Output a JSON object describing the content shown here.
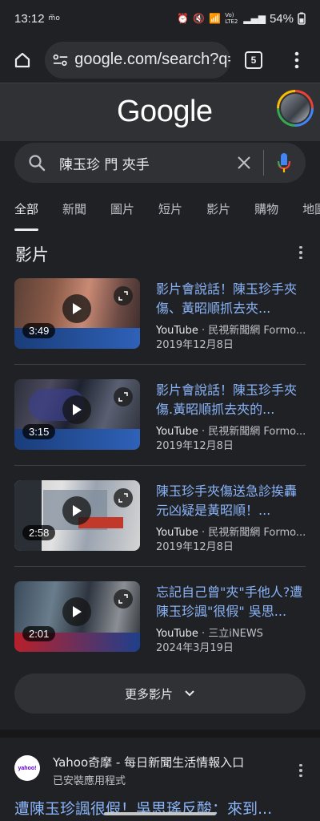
{
  "status_bar": {
    "time": "13:12",
    "small_tag": "m̅o",
    "net_label": "Vo) LTE2",
    "battery": "54%"
  },
  "browser": {
    "url": "google.com/search?q=",
    "tab_count": "5"
  },
  "google": {
    "logo_text": "Google"
  },
  "search": {
    "query": "陳玉珍 門 夾手"
  },
  "tabs": [
    {
      "label": "全部",
      "active": true
    },
    {
      "label": "新聞"
    },
    {
      "label": "圖片"
    },
    {
      "label": "短片"
    },
    {
      "label": "影片"
    },
    {
      "label": "購物"
    },
    {
      "label": "地圖"
    }
  ],
  "videos_section": {
    "title": "影片",
    "items": [
      {
        "title": "影片會說話！陳玉珍手夾傷、黃昭順抓去夾...",
        "source": "YouTube",
        "channel": " · 民視新聞網 Formo...",
        "date": "2019年12月8日",
        "duration": "3:49"
      },
      {
        "title": "影片會說話！陳玉珍手夾傷.黃昭順抓去夾的...",
        "source": "YouTube",
        "channel": " · 民視新聞網 Formo...",
        "date": "2019年12月8日",
        "duration": "3:15"
      },
      {
        "title": "陳玉珍手夾傷送急診挨轟元凶疑是黃昭順！...",
        "source": "YouTube",
        "channel": " · 民視新聞網 Formo...",
        "date": "2019年12月8日",
        "duration": "2:58"
      },
      {
        "title": "忘記自己曾\"夾\"手他人?遭陳玉珍諷\"很假\" 吳思...",
        "source": "YouTube",
        "channel": " · 三立iNEWS",
        "date": "2024年3月19日",
        "duration": "2:01"
      }
    ],
    "more_label": "更多影片"
  },
  "yahoo_result": {
    "logo_text": "yahoo!",
    "name": "Yahoo奇摩 - 每日新聞生活情報入口",
    "sub": "已安裝應用程式",
    "title": "遭陳玉珍諷很假！吳思瑤反酸：來到..."
  }
}
